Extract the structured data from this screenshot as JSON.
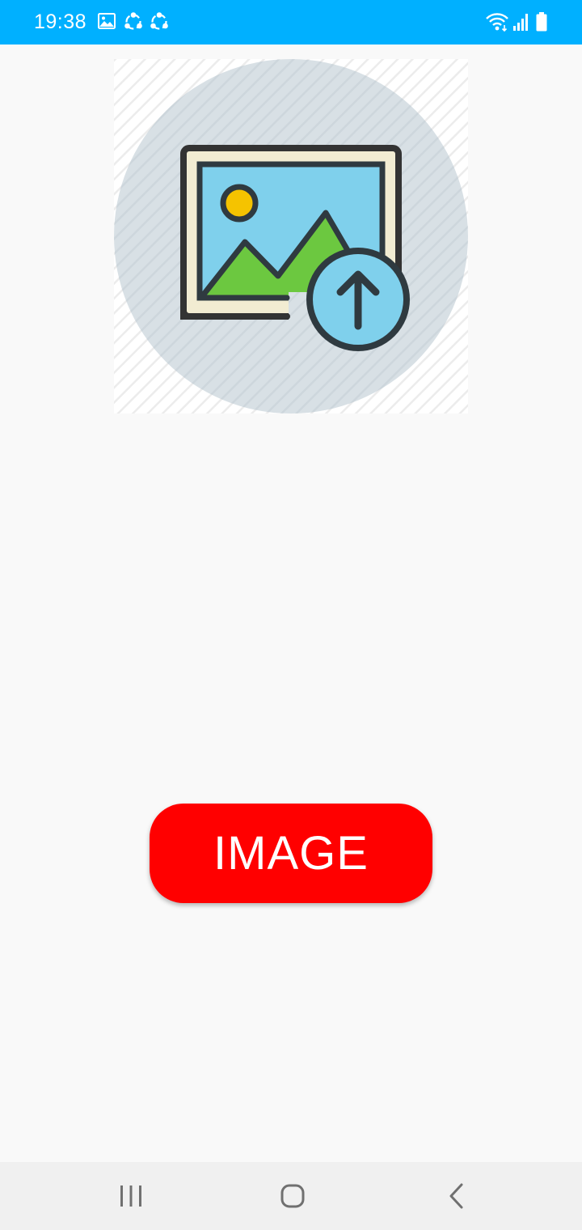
{
  "status_bar": {
    "time": "19:38",
    "background_color": "#00b0ff",
    "left_icons": [
      "gallery-notification-icon",
      "share-notification-icon",
      "share-notification-icon"
    ],
    "right_icons": [
      "wifi-icon",
      "signal-icon",
      "battery-icon"
    ]
  },
  "main": {
    "upload_image_icon": "image-upload-icon",
    "button_label": "IMAGE",
    "button_color": "#ff0000"
  },
  "nav_bar": {
    "buttons": [
      "recent-apps",
      "home",
      "back"
    ]
  }
}
